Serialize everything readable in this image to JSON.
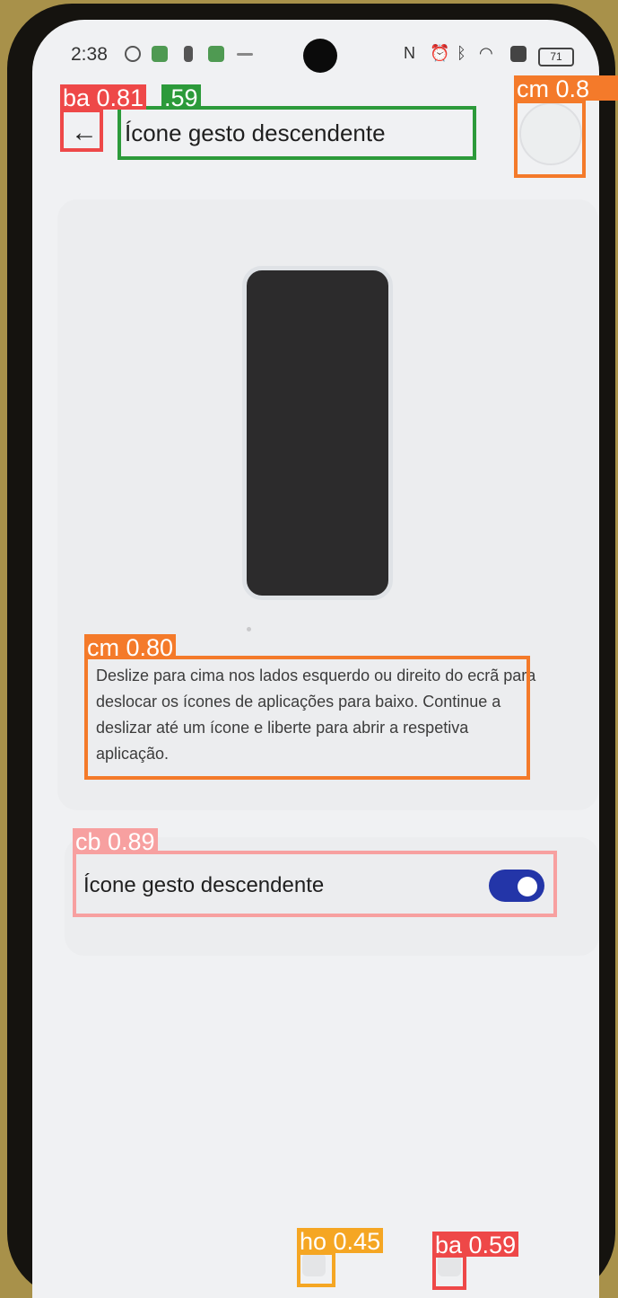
{
  "status_bar": {
    "time": "2:38",
    "battery": "71",
    "icons": [
      "settings-icon",
      "app-icon-green",
      "lock-icon",
      "app-icon-green",
      "more-icon",
      "nfc-icon",
      "alarm-icon",
      "bluetooth-icon",
      "wifi-icon",
      "sim-icon"
    ]
  },
  "header": {
    "back_glyph": "←",
    "title": "Ícone gesto descendente"
  },
  "preview": {
    "description": "Deslize para cima nos lados esquerdo ou direito do ecrã para deslocar os ícones de aplicações para baixo. Continue a deslizar até um ícone e liberte para abrir a respetiva aplicação."
  },
  "setting": {
    "label": "Ícone gesto descendente",
    "enabled": true
  },
  "detections": [
    {
      "label": "ba 0.81",
      "color": "#ee4848"
    },
    {
      "label": ".59",
      "color": "#2c9a3a"
    },
    {
      "label": "cm 0.8",
      "color": "#f47a2a"
    },
    {
      "label": "cm 0.80",
      "color": "#f47a2a"
    },
    {
      "label": "cb 0.89",
      "color": "#f7a0a0"
    },
    {
      "label": "ho 0.45",
      "color": "#f5a623"
    },
    {
      "label": "ba 0.59",
      "color": "#ee4848"
    }
  ]
}
